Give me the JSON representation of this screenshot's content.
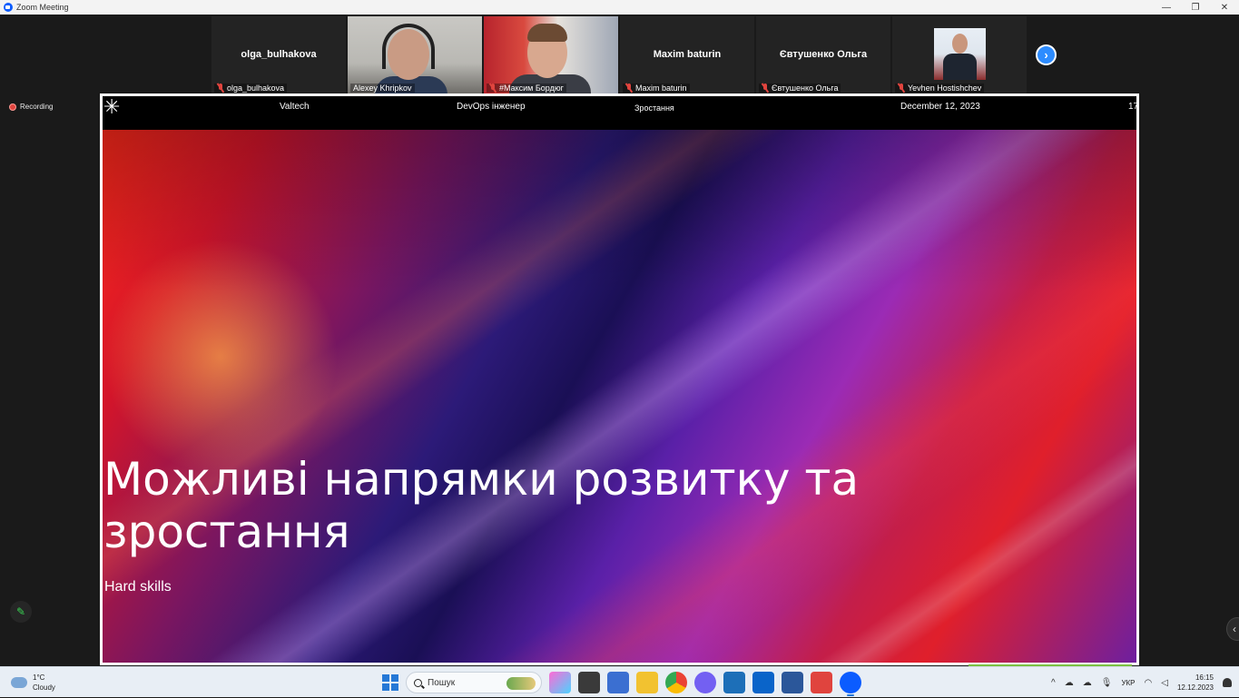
{
  "window": {
    "title": "Zoom Meeting",
    "minimize": "—",
    "maximize": "❐",
    "close": "✕"
  },
  "participants": [
    {
      "display": "olga_bulhakova",
      "label": "olga_bulhakova",
      "video": false,
      "active": false
    },
    {
      "display": "",
      "label": "Alexey Khripkov",
      "video": true,
      "active": true
    },
    {
      "display": "",
      "label": "#Максим Бордюг",
      "video": true,
      "active": false
    },
    {
      "display": "Maxim baturin",
      "label": "Maxim baturin",
      "video": false,
      "active": false
    },
    {
      "display": "Євтушенко Ольга",
      "label": "Євтушенко Ольга",
      "video": false,
      "active": false
    },
    {
      "display": "",
      "label": "Yevhen Hostishchev",
      "video": false,
      "active": false
    }
  ],
  "next_icon": "chevron-right-icon",
  "recording": {
    "label": "Recording",
    "color": "#e0443e"
  },
  "slide": {
    "header": {
      "company": "Valtech",
      "role": "DevOps інженер",
      "section": "Зростання",
      "date": "December 12, 2023",
      "page": "17"
    },
    "title_line1": "Можливі напрямки розвитку та",
    "title_line2": "зростання",
    "subtitle": "Hard skills"
  },
  "accent_color": "#7ac142",
  "taskbar": {
    "weather": {
      "temp": "1°C",
      "condition": "Cloudy"
    },
    "search_placeholder": "Пошук",
    "tray": {
      "language": "УКР",
      "time": "16:15",
      "date": "12.12.2023"
    }
  }
}
